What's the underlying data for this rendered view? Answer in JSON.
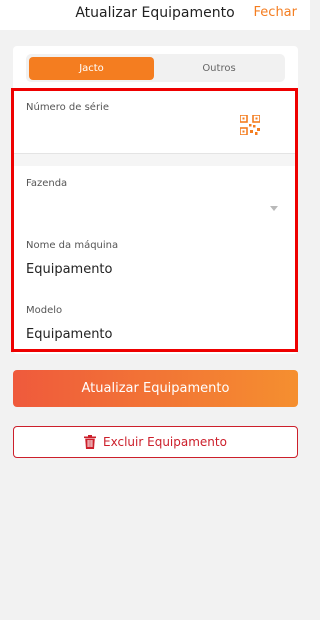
{
  "header": {
    "title": "Atualizar Equipamento",
    "close_label": "Fechar"
  },
  "tabs": [
    {
      "label": "Jacto",
      "active": true
    },
    {
      "label": "Outros",
      "active": false
    }
  ],
  "form": {
    "serial": {
      "label": "Número de série",
      "value": "",
      "icon": "qr-code-icon"
    },
    "farm": {
      "label": "Fazenda",
      "value": "",
      "icon": "chevron-down-icon"
    },
    "machine_name": {
      "label": "Nome da máquina",
      "value": "Equipamento"
    },
    "model": {
      "label": "Modelo",
      "value": "Equipamento"
    }
  },
  "actions": {
    "update_label": "Atualizar Equipamento",
    "delete_label": "Excluir Equipamento",
    "delete_icon": "trash-icon"
  },
  "colors": {
    "accent": "#f47d20",
    "gradient_start": "#ef5a3c",
    "gradient_end": "#f58f2f",
    "danger": "#cc1f2b",
    "highlight": "#ee0000"
  }
}
